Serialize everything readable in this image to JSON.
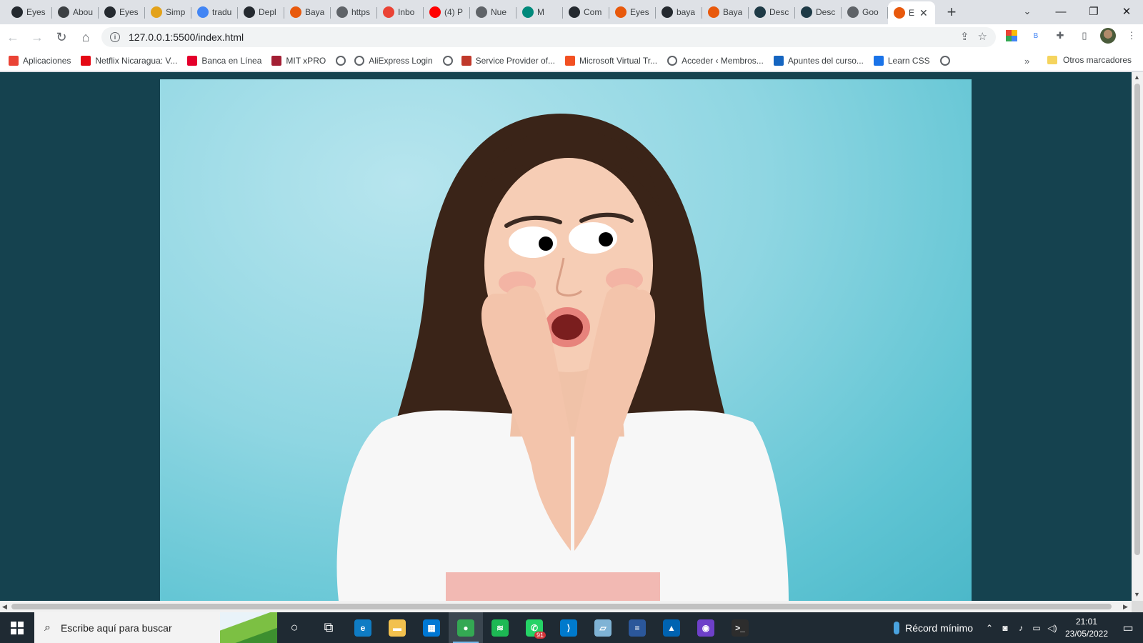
{
  "browser": {
    "tabs": [
      {
        "title": "Eyes",
        "icon": "github-icon",
        "color": "#24292f"
      },
      {
        "title": "Abou",
        "icon": "person-icon",
        "color": "#3c4043"
      },
      {
        "title": "Eyes",
        "icon": "github-icon",
        "color": "#24292f"
      },
      {
        "title": "Simp",
        "icon": "frame-icon",
        "color": "#e3a21a"
      },
      {
        "title": "tradu",
        "icon": "google-icon",
        "color": "#4285f4"
      },
      {
        "title": "Depl",
        "icon": "github-icon",
        "color": "#24292f"
      },
      {
        "title": "Baya",
        "icon": "bayarea-icon",
        "color": "#e8590c"
      },
      {
        "title": "https",
        "icon": "globe-icon",
        "color": "#5f6368"
      },
      {
        "title": "Inbo",
        "icon": "gmail-icon",
        "color": "#ea4335"
      },
      {
        "title": "(4) P",
        "icon": "youtube-icon",
        "color": "#ff0000"
      },
      {
        "title": "Nue",
        "icon": "globe-icon",
        "color": "#5f6368"
      },
      {
        "title": "M",
        "icon": "meet-icon",
        "color": "#00897b"
      },
      {
        "title": "Com",
        "icon": "github-icon",
        "color": "#24292f"
      },
      {
        "title": "Eyes",
        "icon": "bayarea-icon",
        "color": "#e8590c"
      },
      {
        "title": "baya",
        "icon": "github-icon",
        "color": "#24292f"
      },
      {
        "title": "Baya",
        "icon": "bayarea-icon",
        "color": "#e8590c"
      },
      {
        "title": "Desc",
        "icon": "terminal-icon",
        "color": "#1e3a46"
      },
      {
        "title": "Desc",
        "icon": "terminal-icon",
        "color": "#1e3a46"
      },
      {
        "title": "Goo",
        "icon": "globe-icon",
        "color": "#5f6368"
      },
      {
        "title": "E",
        "icon": "bayarea-icon",
        "color": "#e8590c",
        "active": true
      }
    ],
    "new_tab": "+",
    "tab_search": "⌄",
    "window_controls": {
      "minimize": "—",
      "restore": "❐",
      "close": "✕"
    },
    "toolbar": {
      "back": "←",
      "forward": "→",
      "reload": "↻",
      "home": "⌂",
      "url": "127.0.0.1:5500/index.html",
      "info": "i",
      "share": "⇪",
      "bookmark_star": "☆",
      "extensions": "✚",
      "sidepanel": "▯",
      "menu": "⋮",
      "ext_b": "B"
    },
    "bookmarks": [
      {
        "label": "Aplicaciones",
        "icon": "apps-icon",
        "color": "#ea4335"
      },
      {
        "label": "Netflix Nicaragua: V...",
        "icon": "netflix-icon",
        "color": "#e50914"
      },
      {
        "label": "Banca en Línea",
        "icon": "bank-icon",
        "color": "#e4002b"
      },
      {
        "label": "MIT xPRO",
        "icon": "mit-icon",
        "color": "#a31f34"
      },
      {
        "label": "",
        "icon": "globe-icon",
        "color": "#5f6368"
      },
      {
        "label": "AliExpress Login",
        "icon": "globe-icon",
        "color": "#5f6368"
      },
      {
        "label": "",
        "icon": "globe-icon",
        "color": "#5f6368"
      },
      {
        "label": "Service Provider of...",
        "icon": "service-icon",
        "color": "#c0392b"
      },
      {
        "label": "Microsoft Virtual Tr...",
        "icon": "microsoft-icon",
        "color": "#f25022"
      },
      {
        "label": "Acceder ‹ Membros...",
        "icon": "globe-icon",
        "color": "#5f6368"
      },
      {
        "label": "Apuntes del curso...",
        "icon": "course-icon",
        "color": "#1565c0"
      },
      {
        "label": "Learn CSS",
        "icon": "css-icon",
        "color": "#1a73e8"
      },
      {
        "label": "",
        "icon": "globe-icon",
        "color": "#5f6368"
      }
    ],
    "bookmarks_more": "»",
    "other_bookmarks": "Otros marcadores"
  },
  "page": {
    "background": "#15424f",
    "photo_alt": "Woman with hands on cheeks and cartoon eyes looking right"
  },
  "taskbar": {
    "search_placeholder": "Escribe aquí para buscar",
    "apps": [
      {
        "name": "cortana-icon",
        "glyph": "○",
        "color": "transparent"
      },
      {
        "name": "taskview-icon",
        "glyph": "⧉",
        "color": "transparent"
      },
      {
        "name": "edge-icon",
        "glyph": "e",
        "color": "#0f7cc4"
      },
      {
        "name": "file-explorer-icon",
        "glyph": "▬",
        "color": "#f2c14e"
      },
      {
        "name": "store-icon",
        "glyph": "▦",
        "color": "#0078d4"
      },
      {
        "name": "chrome-icon",
        "glyph": "●",
        "color": "#34a853",
        "active": true
      },
      {
        "name": "spotify-icon",
        "glyph": "≋",
        "color": "#1db954"
      },
      {
        "name": "whatsapp-icon",
        "glyph": "✆",
        "color": "#25d366",
        "badge": "91"
      },
      {
        "name": "vscode-icon",
        "glyph": "⟩",
        "color": "#007acc"
      },
      {
        "name": "notes-icon",
        "glyph": "▱",
        "color": "#7fb3d5"
      },
      {
        "name": "word-doc-icon",
        "glyph": "≡",
        "color": "#2b579a"
      },
      {
        "name": "photos-icon",
        "glyph": "▲",
        "color": "#0063b1"
      },
      {
        "name": "github-desktop-icon",
        "glyph": "◉",
        "color": "#6e40c9"
      },
      {
        "name": "terminal-icon",
        "glyph": ">_",
        "color": "#2d2d2d"
      }
    ],
    "weather": "Récord mínimo",
    "time": "21:01",
    "date": "23/05/2022"
  }
}
